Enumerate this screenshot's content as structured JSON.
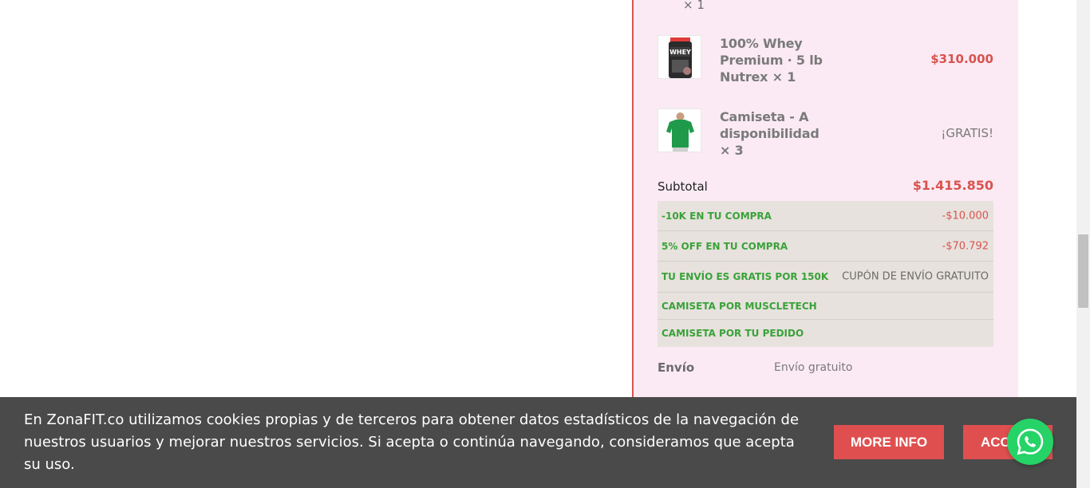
{
  "summary": {
    "top_qty": "× 1",
    "items": [
      {
        "name": "100% Whey Premium · 5 lb Nutrex  × 1",
        "price": "$310.000",
        "thumb": "protein-tub-icon"
      },
      {
        "name": "Camiseta - A disponibilidad × 3",
        "price": "¡GRATIS!",
        "thumb": "green-shirt-icon"
      }
    ],
    "subtotal_label": "Subtotal",
    "subtotal_value": "$1.415.850",
    "coupons": [
      {
        "name": "-10K EN TU COMPRA",
        "value": "-$10.000"
      },
      {
        "name": "5% OFF EN TU COMPRA",
        "value": "-$70.792"
      },
      {
        "name": "TU ENVÍO ES GRATIS POR 150K",
        "value": "CUPÓN DE ENVÍO GRATUITO"
      },
      {
        "name": "CAMISETA POR MUSCLETECH",
        "value": ""
      },
      {
        "name": "CAMISETA POR TU PEDIDO",
        "value": ""
      }
    ],
    "shipping_label": "Envío",
    "shipping_value": "Envío gratuito"
  },
  "cookie": {
    "text": "En ZonaFIT.co utilizamos cookies propias y de terceros para obtener datos estadísticos de la navegación de nuestros usuarios y mejorar nuestros servicios. Si acepta o continúa navegando, consideramos que acepta su uso.",
    "more_info": "MORE INFO",
    "accept": "ACCEPT"
  },
  "colors": {
    "accent": "#df4f4f",
    "price": "#d9534f",
    "coupon_green": "#3aa23a",
    "panel_bg": "#fbeaf3",
    "whatsapp": "#25d366"
  }
}
